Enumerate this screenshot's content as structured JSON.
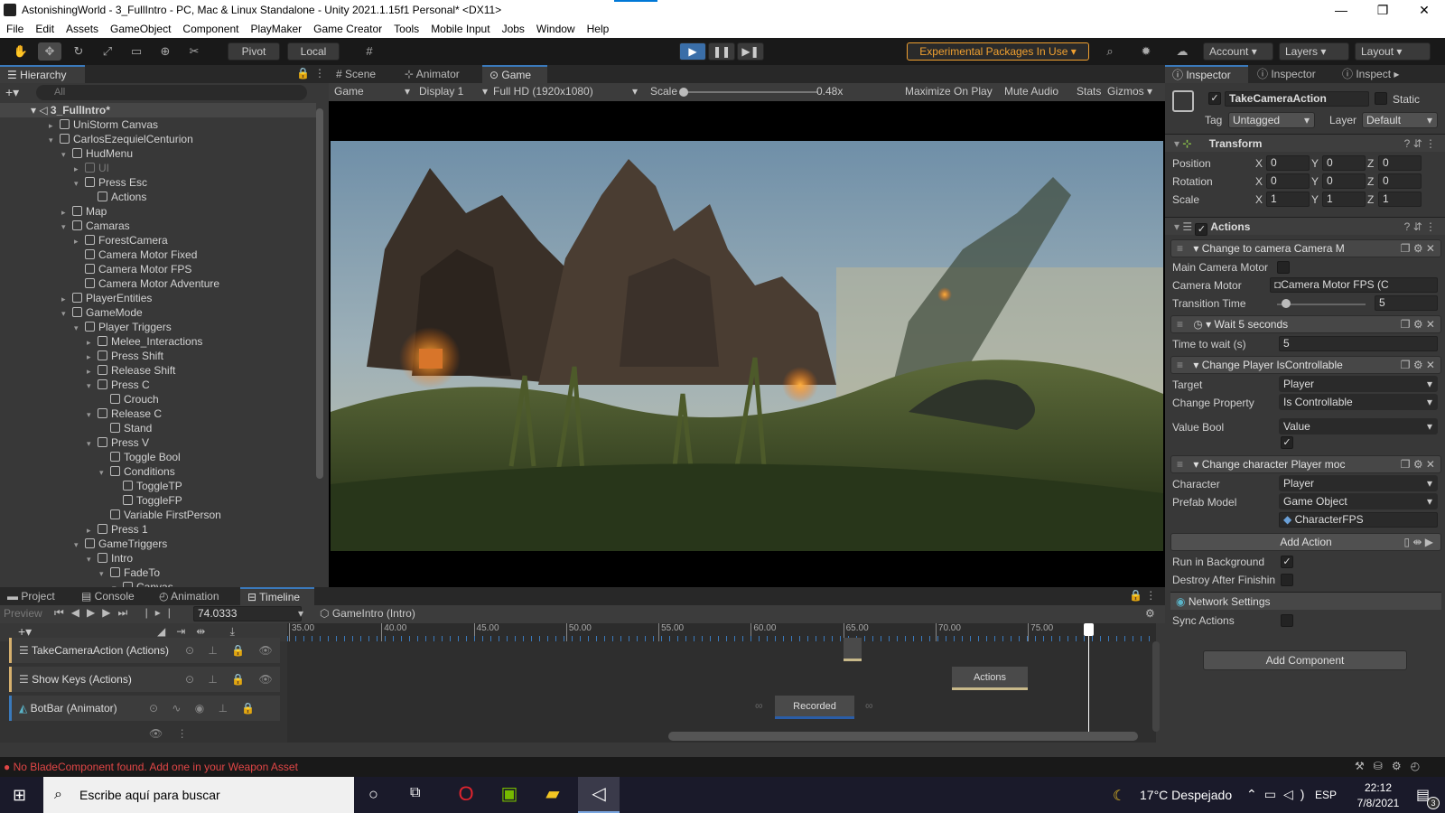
{
  "window": {
    "title": "AstonishingWorld - 3_FullIntro - PC, Mac & Linux Standalone - Unity 2021.1.15f1 Personal* <DX11>",
    "minimize": "—",
    "maximize": "❐",
    "close": "✕"
  },
  "menu": [
    "File",
    "Edit",
    "Assets",
    "GameObject",
    "Component",
    "PlayMaker",
    "Game Creator",
    "Tools",
    "Mobile Input",
    "Jobs",
    "Window",
    "Help"
  ],
  "toolbar": {
    "pivot": "Pivot",
    "local": "Local",
    "experimental": "Experimental Packages In Use ▾",
    "account": "Account",
    "layers": "Layers",
    "layout": "Layout",
    "accent_color": "#f0a030"
  },
  "hierarchy": {
    "tab": "Hierarchy",
    "search_placeholder": "All",
    "scene": "3_FullIntro*",
    "items": [
      {
        "label": "UniStorm Canvas",
        "depth": 1,
        "fold": "▸"
      },
      {
        "label": "CarlosEzequielCenturion",
        "depth": 1,
        "fold": "▾"
      },
      {
        "label": "HudMenu",
        "depth": 2,
        "fold": "▾"
      },
      {
        "label": "UI",
        "depth": 3,
        "fold": "▸",
        "dim": true
      },
      {
        "label": "Press Esc",
        "depth": 3,
        "fold": "▾"
      },
      {
        "label": "Actions",
        "depth": 4,
        "fold": ""
      },
      {
        "label": "Map",
        "depth": 2,
        "fold": "▸"
      },
      {
        "label": "Camaras",
        "depth": 2,
        "fold": "▾"
      },
      {
        "label": "ForestCamera",
        "depth": 3,
        "fold": "▸"
      },
      {
        "label": "Camera Motor Fixed",
        "depth": 3,
        "fold": ""
      },
      {
        "label": "Camera Motor FPS",
        "depth": 3,
        "fold": ""
      },
      {
        "label": "Camera Motor Adventure",
        "depth": 3,
        "fold": ""
      },
      {
        "label": "PlayerEntities",
        "depth": 2,
        "fold": "▸"
      },
      {
        "label": "GameMode",
        "depth": 2,
        "fold": "▾"
      },
      {
        "label": "Player Triggers",
        "depth": 3,
        "fold": "▾"
      },
      {
        "label": "Melee_Interactions",
        "depth": 4,
        "fold": "▸"
      },
      {
        "label": "Press Shift",
        "depth": 4,
        "fold": "▸"
      },
      {
        "label": "Release Shift",
        "depth": 4,
        "fold": "▸"
      },
      {
        "label": "Press C",
        "depth": 4,
        "fold": "▾"
      },
      {
        "label": "Crouch",
        "depth": 5,
        "fold": ""
      },
      {
        "label": "Release C",
        "depth": 4,
        "fold": "▾"
      },
      {
        "label": "Stand",
        "depth": 5,
        "fold": ""
      },
      {
        "label": "Press V",
        "depth": 4,
        "fold": "▾"
      },
      {
        "label": "Toggle Bool",
        "depth": 5,
        "fold": ""
      },
      {
        "label": "Conditions",
        "depth": 5,
        "fold": "▾"
      },
      {
        "label": "ToggleTP",
        "depth": 6,
        "fold": ""
      },
      {
        "label": "ToggleFP",
        "depth": 6,
        "fold": ""
      },
      {
        "label": "Variable FirstPerson",
        "depth": 5,
        "fold": ""
      },
      {
        "label": "Press 1",
        "depth": 4,
        "fold": "▸"
      },
      {
        "label": "GameTriggers",
        "depth": 3,
        "fold": "▾"
      },
      {
        "label": "Intro",
        "depth": 4,
        "fold": "▾"
      },
      {
        "label": "FadeTo",
        "depth": 5,
        "fold": "▾"
      },
      {
        "label": "Canvas",
        "depth": 6,
        "fold": "▾"
      }
    ]
  },
  "viewport": {
    "tabs": [
      "Scene",
      "Animator",
      "Game"
    ],
    "game_label": "Game",
    "display": "Display 1",
    "resolution": "Full HD (1920x1080)",
    "scale_label": "Scale",
    "scale_value": "0.48x",
    "maximize": "Maximize On Play",
    "mute": "Mute Audio",
    "stats": "Stats",
    "gizmos": "Gizmos"
  },
  "inspector": {
    "tabs": [
      "Inspector",
      "Inspector",
      "Inspect"
    ],
    "object_name": "TakeCameraAction",
    "static_label": "Static",
    "tag_label": "Tag",
    "tag_value": "Untagged",
    "layer_label": "Layer",
    "layer_value": "Default",
    "transform": {
      "title": "Transform",
      "rows": [
        {
          "label": "Position",
          "x": "0",
          "y": "0",
          "z": "0"
        },
        {
          "label": "Rotation",
          "x": "0",
          "y": "0",
          "z": "0"
        },
        {
          "label": "Scale",
          "x": "1",
          "y": "1",
          "z": "1"
        }
      ]
    },
    "actions_title": "Actions",
    "action1": {
      "title": "Change to camera Camera M",
      "main_camera_label": "Main Camera Motor",
      "camera_motor_label": "Camera Motor",
      "camera_motor_value": "Camera Motor FPS (C",
      "transition_label": "Transition Time",
      "transition_value": "5",
      "transition_fraction": 0.05
    },
    "action2": {
      "title": "Wait 5 seconds",
      "time_label": "Time to wait (s)",
      "time_value": "5"
    },
    "action3": {
      "title": "Change Player IsControllable",
      "target_label": "Target",
      "target_value": "Player",
      "property_label": "Change Property",
      "property_value": "Is Controllable",
      "value_label": "Value Bool",
      "value_value": "Value"
    },
    "action4": {
      "title": "Change character Player moc",
      "character_label": "Character",
      "character_value": "Player",
      "prefab_label": "Prefab Model",
      "prefab_value": "Game Object",
      "prefab_object": "CharacterFPS"
    },
    "add_action": "Add Action",
    "run_bg": "Run in Background",
    "destroy": "Destroy After Finishin",
    "network": "Network Settings",
    "sync": "Sync Actions",
    "add_component": "Add Component"
  },
  "bottom": {
    "tabs": [
      "Project",
      "Console",
      "Animation",
      "Timeline"
    ],
    "preview": "Preview",
    "time": "74.0333",
    "asset": "GameIntro (Intro)",
    "ruler": [
      "35.00",
      "40.00",
      "45.00",
      "50.00",
      "55.00",
      "60.00",
      "65.00",
      "70.00",
      "75.00"
    ],
    "tracks": [
      {
        "label": "TakeCameraAction (Actions)"
      },
      {
        "label": "Show Keys (Actions)"
      },
      {
        "label": "BotBar (Animator)"
      }
    ],
    "clip_actions": "Actions",
    "clip_recorded": "Recorded",
    "recorded_color": "#2a5da8"
  },
  "status": {
    "error": "No BladeComponent found. Add one in your Weapon Asset",
    "error_color": "#e04646"
  },
  "taskbar": {
    "search_placeholder": "Escribe aquí para buscar",
    "weather": "17°C  Despejado",
    "lang": "ESP",
    "time": "22:12",
    "date": "7/8/2021",
    "notif": "3"
  }
}
